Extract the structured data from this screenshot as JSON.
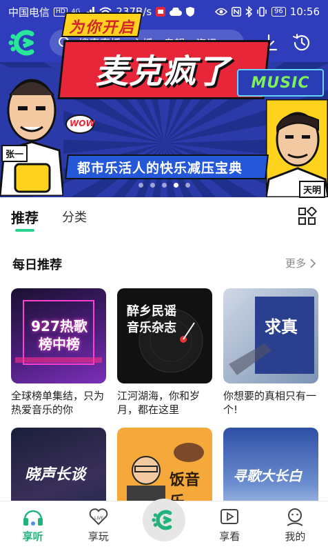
{
  "status_bar": {
    "carrier": "中国电信",
    "hd": "HD",
    "network": "4G",
    "speed": "237B/s",
    "battery": "96",
    "time": "10:56"
  },
  "header": {
    "search_placeholder": "搜索直播、主播、专辑、资讯",
    "brand_color": "#2f3dbd",
    "accent_color": "#28d28e"
  },
  "banner": {
    "tagline": "为你开启",
    "title": "麦克疯了",
    "subtitle": "都市乐活人的快乐减压宝典",
    "badge": "WOW",
    "music_sign": "MUSIC",
    "name_left": "张一",
    "name_right": "天明",
    "page_count": 5,
    "active_page": 4
  },
  "tabs": [
    {
      "label": "推荐",
      "active": true
    },
    {
      "label": "分类",
      "active": false
    }
  ],
  "daily": {
    "title": "每日推荐",
    "more": "更多"
  },
  "cards": [
    {
      "cover_title": "927热歌榜中榜",
      "text": "全球榜单集结，只为热爱音乐的你"
    },
    {
      "cover_title": "醉乡民谣音乐杂志",
      "text": "江河湖海，你和岁月，都在这里"
    },
    {
      "cover_title": "求真",
      "text": "你想要的真相只有一个!"
    },
    {
      "cover_title": "晓声长谈",
      "text": ""
    },
    {
      "cover_title": "饭音乐",
      "text": ""
    },
    {
      "cover_title": "寻歌大长白",
      "text": ""
    }
  ],
  "bottom_nav": [
    {
      "label": "享听",
      "icon": "headphones-icon",
      "active": true
    },
    {
      "label": "享玩",
      "icon": "live-heart-icon",
      "active": false
    },
    {
      "label": "",
      "icon": "app-logo-icon",
      "active": false
    },
    {
      "label": "享看",
      "icon": "video-play-icon",
      "active": false
    },
    {
      "label": "我的",
      "icon": "profile-icon",
      "active": false
    }
  ]
}
